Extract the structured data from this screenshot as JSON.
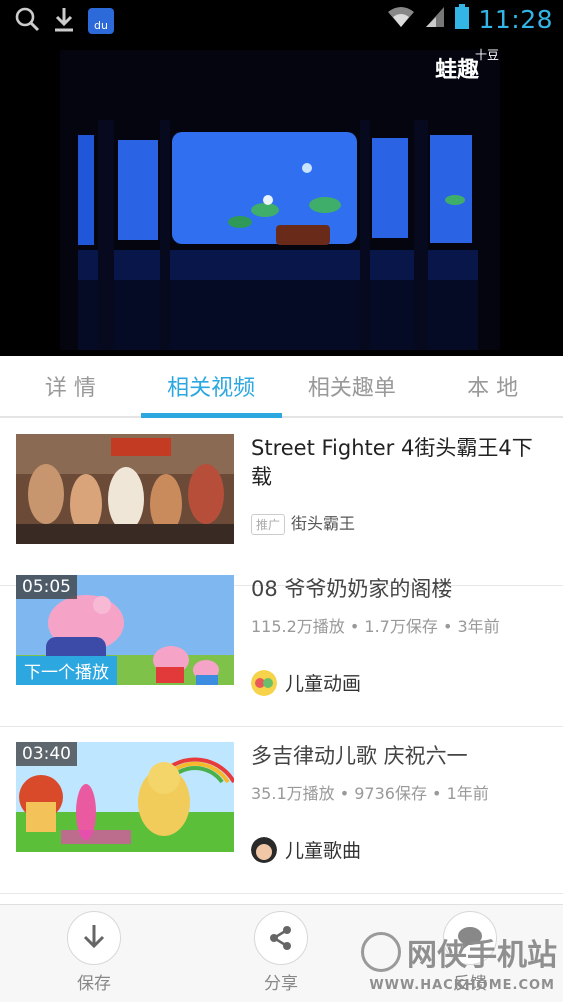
{
  "status_bar": {
    "time": "11:28",
    "du_label": "du",
    "icons": [
      "search-icon",
      "download-icon",
      "baidu-icon",
      "wifi-icon",
      "signal-icon",
      "battery-icon"
    ]
  },
  "video": {
    "watermark": "蛙趣",
    "watermark_sup": "十豆"
  },
  "tabs": [
    {
      "label": "详 情",
      "active": false
    },
    {
      "label": "相关视频",
      "active": true
    },
    {
      "label": "相关趣单",
      "active": false
    },
    {
      "label": "本 地",
      "active": false
    }
  ],
  "items": [
    {
      "title": "Street Fighter 4街头霸王4下载",
      "promo_tag": "推广",
      "promo_name": "街头霸王"
    },
    {
      "duration": "05:05",
      "next_label": "下一个播放",
      "title": "08 爷爷奶奶家的阁楼",
      "stats": "115.2万播放 • 1.7万保存 • 3年前",
      "channel": "儿童动画"
    },
    {
      "duration": "03:40",
      "title": "多吉律动儿歌 庆祝六一",
      "stats": "35.1万播放 • 9736保存 • 1年前",
      "channel": "儿童歌曲"
    }
  ],
  "bottom_bar": {
    "save_label": "保存",
    "share_label": "分享",
    "feedback_label": "反馈"
  },
  "site_mark": {
    "name": "网侠手机站",
    "url": "WWW.HACKHOME.COM"
  },
  "colors": {
    "accent": "#2ca7e0",
    "status_time": "#33b5e5"
  }
}
